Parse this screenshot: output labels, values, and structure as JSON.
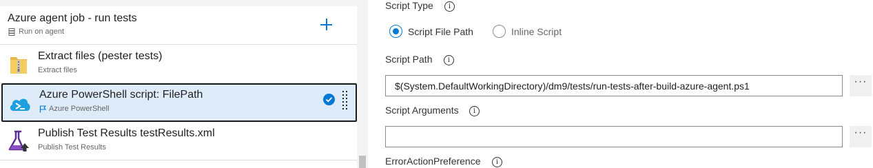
{
  "job": {
    "title": "Azure agent job - run tests",
    "subtitle": "Run on agent"
  },
  "tasks": [
    {
      "title": "Extract files (pester tests)",
      "subtitle": "Extract files",
      "icon": "zip-folder-icon"
    },
    {
      "title": "Azure PowerShell script: FilePath",
      "subtitle": "Azure PowerShell",
      "icon": "azure-powershell-icon",
      "selected": true
    },
    {
      "title": "Publish Test Results testResults.xml",
      "subtitle": "Publish Test Results",
      "icon": "flask-upload-icon"
    }
  ],
  "form": {
    "script_type_label": "Script Type",
    "script_type_options": [
      "Script File Path",
      "Inline Script"
    ],
    "script_type_selected": "Script File Path",
    "script_path_label": "Script Path",
    "script_path_value": "$(System.DefaultWorkingDirectory)/dm9/tests/run-tests-after-build-azure-agent.ps1",
    "script_arguments_label": "Script Arguments",
    "script_arguments_value": "",
    "error_action_label": "ErrorActionPreference",
    "info_glyph": "i",
    "more_glyph": "···"
  },
  "colors": {
    "accent": "#0078d4",
    "selected_bg": "#deecf9"
  }
}
